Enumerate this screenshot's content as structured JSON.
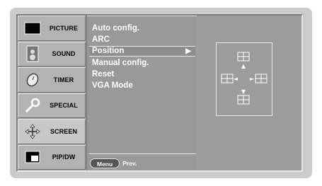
{
  "sidebar": {
    "items": [
      {
        "label": "PICTURE",
        "icon": "tv-screen-icon"
      },
      {
        "label": "SOUND",
        "icon": "speaker-icon"
      },
      {
        "label": "TIMER",
        "icon": "clock-icon"
      },
      {
        "label": "SPECIAL",
        "icon": "wrench-icon"
      },
      {
        "label": "SCREEN",
        "icon": "screen-adjust-icon",
        "selected": true
      },
      {
        "label": "PIP/DW",
        "icon": "pip-icon"
      }
    ]
  },
  "menu": {
    "items": [
      {
        "label": "Auto config."
      },
      {
        "label": "ARC"
      },
      {
        "label": "Position",
        "selected": true
      },
      {
        "label": "Manual config."
      },
      {
        "label": "Reset"
      },
      {
        "label": "VGA Mode"
      }
    ],
    "selected_arrow": "▶",
    "footer": {
      "button": "Menu",
      "label": "Prev."
    }
  },
  "position_diagram": {
    "up_arrow": "▲",
    "down_arrow": "▼",
    "left_arrow": "◄",
    "right_arrow": "►"
  },
  "colors": {
    "panel": "#a2a2a2",
    "menu": "#999999",
    "frame": "#cbcbcb",
    "text": "#ffffff"
  }
}
